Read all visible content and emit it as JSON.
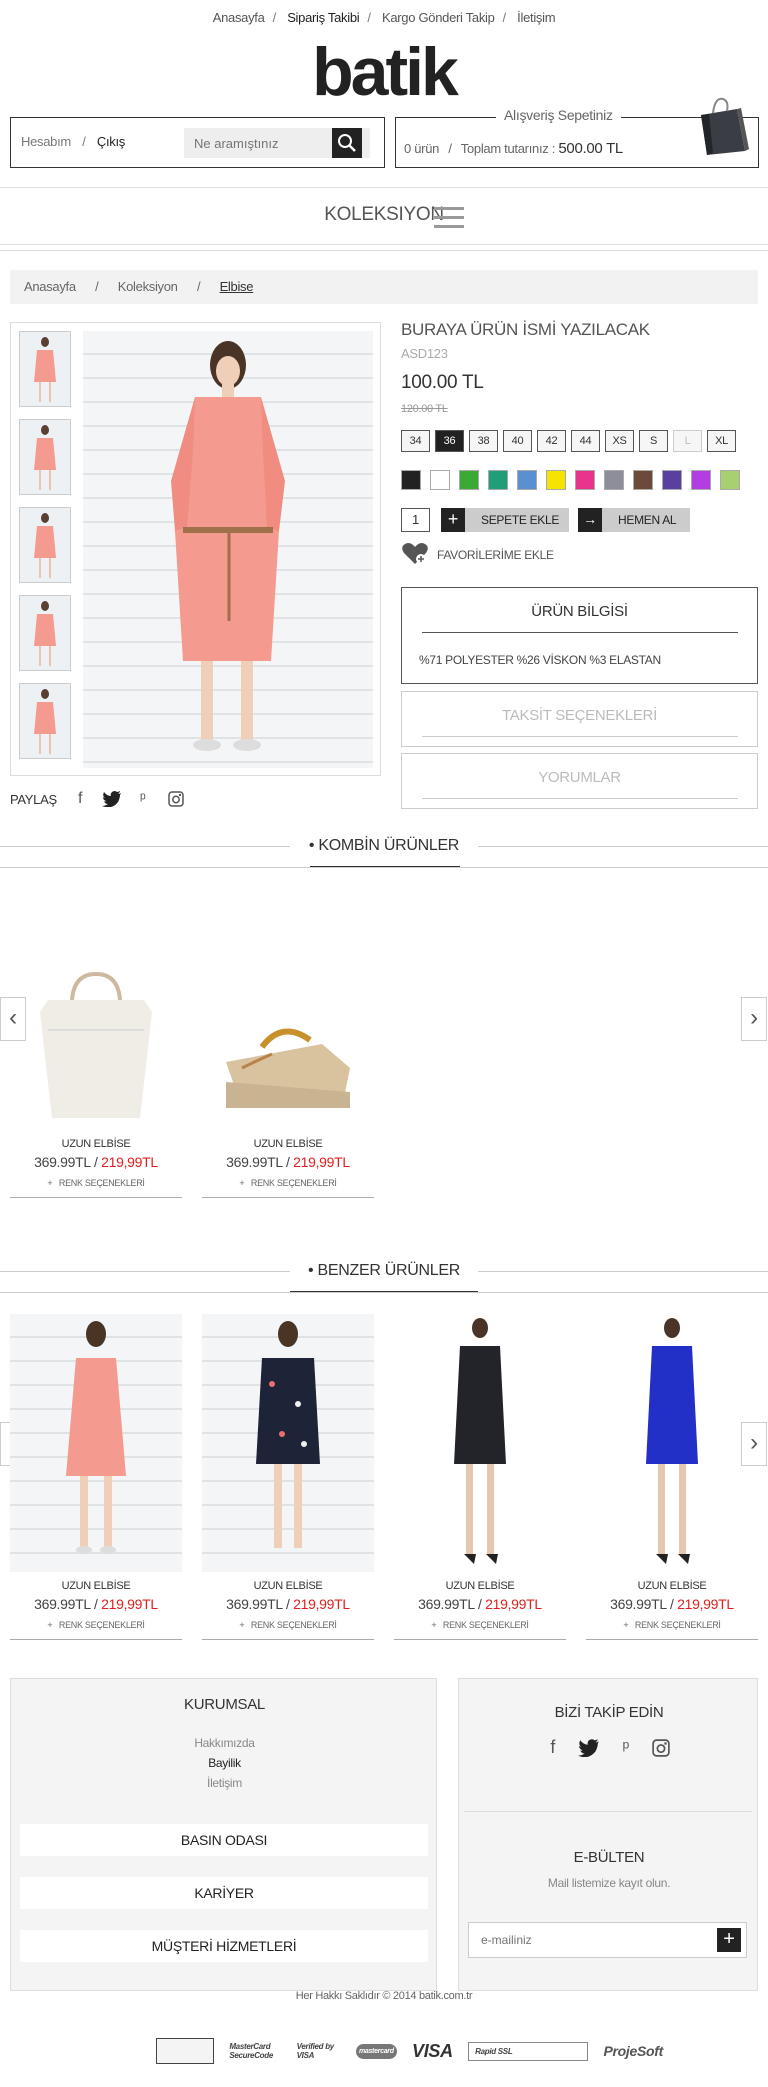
{
  "topnav": {
    "items": [
      "Anasayfa",
      "Sipariş Takibi",
      "Kargo Gönderi Takip",
      "İletişim"
    ],
    "sep": "/"
  },
  "logo": "batik",
  "account": {
    "link1": "Hesabım",
    "sep": "/",
    "link2": "Çıkış"
  },
  "search": {
    "placeholder": "Ne aramıştınız"
  },
  "cart": {
    "title": "Alışveriş Sepetiniz",
    "count": "0 ürün",
    "sep": "/",
    "total_label": "Toplam tutarınız :",
    "total": "500.00 TL"
  },
  "collection": "KOLEKSIYON",
  "breadcrumb": [
    "Anasayfa",
    "/",
    "Koleksiyon",
    "/",
    "Elbise"
  ],
  "share_label": "PAYLAŞ",
  "product": {
    "title": "BURAYA ÜRÜN İSMİ YAZILACAK",
    "code": "ASD123",
    "price": "100.00 TL",
    "old_price": "120.00 TL",
    "sizes": [
      "34",
      "36",
      "38",
      "40",
      "42",
      "44",
      "XS",
      "S",
      "L",
      "XL"
    ],
    "colors": [
      "#222222",
      "#ffffff",
      "#3aaa35",
      "#1f9e77",
      "#5a8fd0",
      "#f5e400",
      "#e8358b",
      "#8e8e9a",
      "#6b4a3a",
      "#5a3fa0",
      "#b23de0",
      "#a8d070"
    ],
    "qty": "1",
    "add_label": "SEPETE EKLE",
    "buy_label": "HEMEN AL",
    "fav_label": "FAVORİLERİME EKLE"
  },
  "panels": {
    "info_title": "ÜRÜN BİLGİSİ",
    "info_body": "%71 POLYESTER %26 VİSKON %3 ELASTAN",
    "taksit_title": "TAKSİT SEÇENEKLERİ",
    "yorum_title": "YORUMLAR"
  },
  "sections": {
    "combo": "KOMBİN ÜRÜNLER",
    "similar": "BENZER ÜRÜNLER"
  },
  "combo_products": [
    {
      "name": "UZUN ELBİSE",
      "price": "369.99TL",
      "sep": "/",
      "sale": "219,99TL",
      "opt": "RENK SEÇENEKLERİ"
    },
    {
      "name": "UZUN ELBİSE",
      "price": "369.99TL",
      "sep": "/",
      "sale": "219,99TL",
      "opt": "RENK SEÇENEKLERİ"
    }
  ],
  "similar_products": [
    {
      "name": "UZUN ELBİSE",
      "price": "369.99TL",
      "sep": "/",
      "sale": "219,99TL",
      "opt": "RENK SEÇENEKLERİ"
    },
    {
      "name": "UZUN ELBİSE",
      "price": "369.99TL",
      "sep": "/",
      "sale": "219,99TL",
      "opt": "RENK SEÇENEKLERİ"
    },
    {
      "name": "UZUN ELBİSE",
      "price": "369.99TL",
      "sep": "/",
      "sale": "219,99TL",
      "opt": "RENK SEÇENEKLERİ"
    },
    {
      "name": "UZUN ELBİSE",
      "price": "369.99TL",
      "sep": "/",
      "sale": "219,99TL",
      "opt": "RENK SEÇENEKLERİ"
    }
  ],
  "footer": {
    "kurumsal": "KURUMSAL",
    "links": [
      "Hakkımızda",
      "Bayilik",
      "İletişim"
    ],
    "buttons": [
      "BASIN ODASI",
      "KARİYER",
      "MÜŞTERİ HİZMETLERİ"
    ],
    "follow": "BİZİ TAKİP EDİN",
    "ebulten": "E-BÜLTEN",
    "ebulten_sub": "Mail listemize kayıt olun.",
    "email_placeholder": "e-mailiniz",
    "copyright": "Her Hakkı Saklıdır © 2014  batik.com.tr",
    "pay": [
      "MasterCard SecureCode",
      "Verified by VISA",
      "mastercard",
      "VISA",
      "Rapid SSL",
      "ProjeSoft"
    ]
  }
}
